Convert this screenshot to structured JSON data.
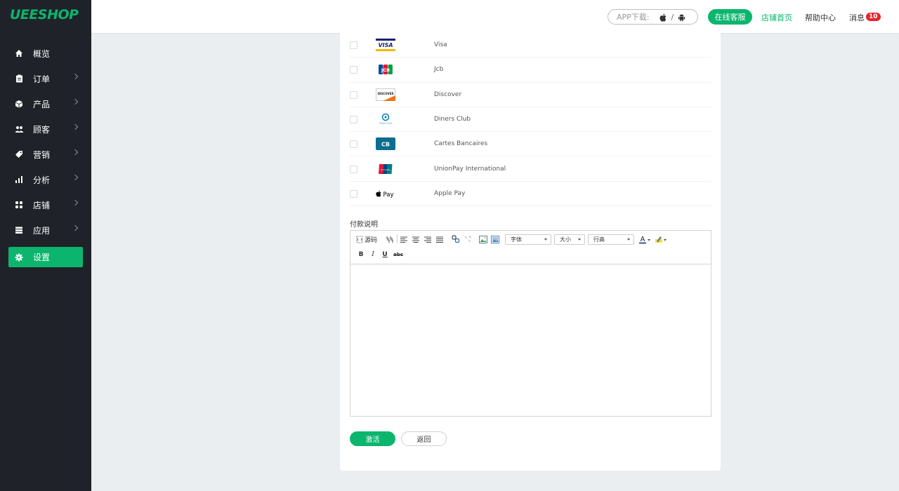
{
  "app": {
    "logo": "UEESHOP"
  },
  "sidebar": {
    "items": [
      {
        "label": "概览",
        "icon": "home-icon",
        "has_chevron": false
      },
      {
        "label": "订单",
        "icon": "clipboard-icon",
        "has_chevron": true
      },
      {
        "label": "产品",
        "icon": "box-icon",
        "has_chevron": true
      },
      {
        "label": "顾客",
        "icon": "users-icon",
        "has_chevron": true
      },
      {
        "label": "营销",
        "icon": "tag-icon",
        "has_chevron": true
      },
      {
        "label": "分析",
        "icon": "bar-chart-icon",
        "has_chevron": true
      },
      {
        "label": "店铺",
        "icon": "grid-icon",
        "has_chevron": true
      },
      {
        "label": "应用",
        "icon": "stack-icon",
        "has_chevron": true
      },
      {
        "label": "设置",
        "icon": "gear-icon",
        "has_chevron": false,
        "active": true
      }
    ]
  },
  "header": {
    "app_download_label": "APP下载:",
    "app_download_sep": "/",
    "service_button": "在线客服",
    "store_home": "店铺首页",
    "help_center": "帮助中心",
    "messages": "消息",
    "message_count": "10"
  },
  "payments": [
    {
      "name": "Visa",
      "logo_text": "VISA",
      "checked": false
    },
    {
      "name": "Jcb",
      "logo_text": "JCB",
      "checked": false
    },
    {
      "name": "Discover",
      "logo_text": "DISCOVER",
      "checked": false
    },
    {
      "name": "Diners Club",
      "logo_text": "Diners Club",
      "checked": false
    },
    {
      "name": "Cartes Bancaires",
      "logo_text": "CB",
      "checked": false
    },
    {
      "name": "UnionPay International",
      "logo_text": "UnionPay",
      "checked": false
    },
    {
      "name": "Apple Pay",
      "logo_text": "Pay",
      "checked": false
    }
  ],
  "form": {
    "section_label": "付款说明",
    "editor": {
      "source_label": "源码",
      "font_select": "字体",
      "size_select": "大小",
      "lineheight_select": "行高",
      "bold": "B",
      "italic": "I",
      "underline": "U",
      "strike": "abc"
    },
    "activate_button": "激活",
    "back_button": "返回"
  },
  "colors": {
    "brand": "#0bb56d",
    "sidebar_bg": "#1f2329",
    "page_bg": "#ebeef1",
    "badge": "#e5242b"
  }
}
